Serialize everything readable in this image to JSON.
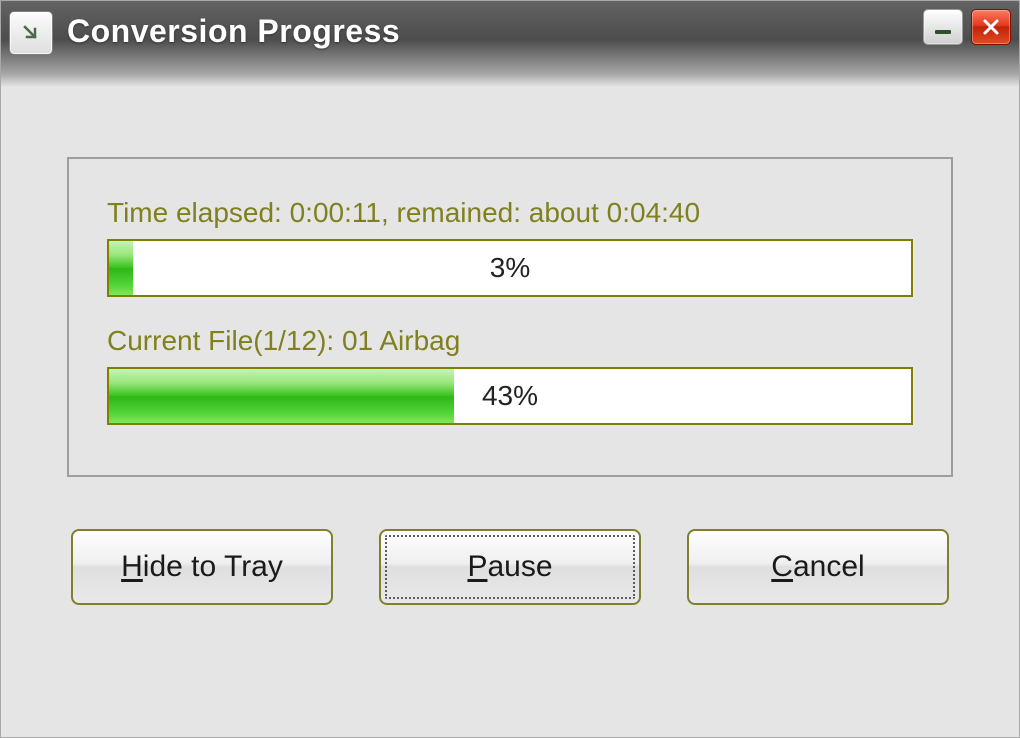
{
  "window": {
    "title": "Conversion Progress"
  },
  "progress": {
    "overall": {
      "label": "Time elapsed: 0:00:11, remained: about 0:04:40",
      "percent_text": "3%",
      "percent_css": "3%"
    },
    "file": {
      "label": "Current File(1/12): 01 Airbag",
      "percent_text": "43%",
      "percent_css": "43%"
    }
  },
  "buttons": {
    "hide_pre": "H",
    "hide_post": "ide to Tray",
    "pause_pre": "P",
    "pause_post": "ause",
    "cancel_pre": "C",
    "cancel_post": "ancel"
  }
}
